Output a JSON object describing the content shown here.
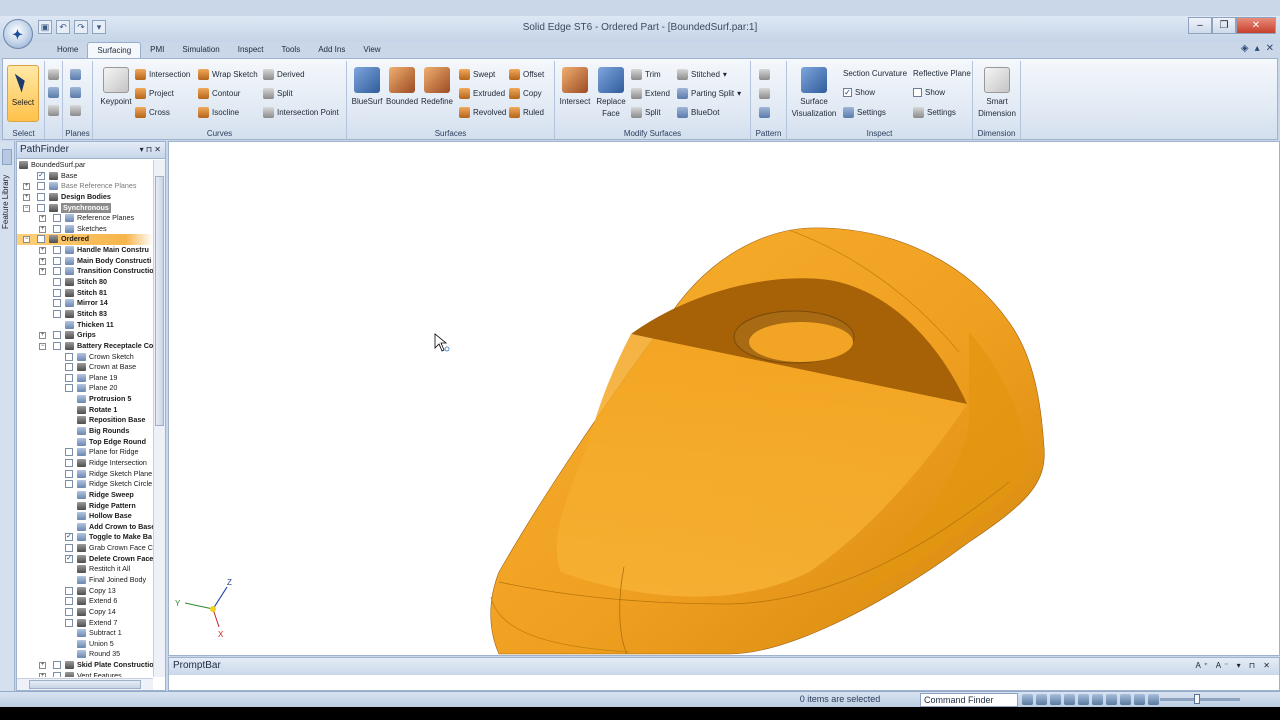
{
  "window": {
    "title": "Solid Edge ST6 - Ordered Part - [BoundedSurf.par:1]"
  },
  "tabs": [
    "Home",
    "Surfacing",
    "PMI",
    "Simulation",
    "Inspect",
    "Tools",
    "Add Ins",
    "View"
  ],
  "active_tab": "Surfacing",
  "ribbon": {
    "select": {
      "label": "Select",
      "group": "Select"
    },
    "planes": {
      "group": "Planes"
    },
    "curves": {
      "group": "Curves",
      "keypoint": "Keypoint",
      "col1": [
        "Intersection",
        "Project",
        "Cross"
      ],
      "col2": [
        "Wrap Sketch",
        "Contour",
        "Isocline"
      ],
      "col3": [
        "Derived",
        "Split",
        "Intersection Point"
      ]
    },
    "surfaces": {
      "group": "Surfaces",
      "big": [
        "BlueSurf",
        "Bounded",
        "Redefine"
      ],
      "col1": [
        "Swept",
        "Extruded",
        "Revolved"
      ],
      "col2": [
        "Offset",
        "Copy",
        "Ruled"
      ]
    },
    "modify": {
      "group": "Modify Surfaces",
      "intersect": "Intersect",
      "replace": "Replace Face",
      "col1": [
        "Trim",
        "Extend",
        "Split"
      ],
      "col2": [
        "Stitched",
        "Parting Split",
        "BlueDot"
      ]
    },
    "pattern": {
      "group": "Pattern"
    },
    "inspect": {
      "group": "Inspect",
      "surface_vis": "Surface Visualization",
      "section_curvature": "Section Curvature",
      "show": "Show",
      "settings": "Settings",
      "reflective_plane": "Reflective Plane",
      "show2": "Show",
      "settings2": "Settings"
    },
    "dimension": {
      "group": "Dimension",
      "smart": "Smart Dimension"
    }
  },
  "side_tab": "Feature Library",
  "pathfinder": {
    "title": "PathFinder",
    "items": [
      "BoundedSurf.par",
      "Base",
      "Base Reference Planes",
      "Design Bodies",
      "Synchronous",
      "Reference Planes",
      "Sketches",
      "Ordered",
      "Handle Main Constru",
      "Main Body Constructi",
      "Transition Constructio",
      "Stitch 80",
      "Stitch 81",
      "Mirror 14",
      "Stitch 83",
      "Thicken 11",
      "Grips",
      "Battery Receptacle Co",
      "Crown Sketch",
      "Crown at Base",
      "Plane 19",
      "Plane 20",
      "Protrusion 5",
      "Rotate 1",
      "Reposition Base",
      "Big Rounds",
      "Top Edge Round",
      "Plane for Ridge",
      "Ridge Intersection",
      "Ridge Sketch Plane",
      "Ridge Sketch Circle",
      "Ridge Sweep",
      "Ridge Pattern",
      "Hollow Base",
      "Add Crown to Base",
      "Toggle to Make Ba",
      "Grab Crown Face C",
      "Delete Crown Face",
      "Restitch it All",
      "Final Joined Body",
      "Copy 13",
      "Extend 6",
      "Copy 14",
      "Extend 7",
      "Subtract 1",
      "Union 5",
      "Round 35",
      "Skid Plate Constructio",
      "Vent Features"
    ]
  },
  "triad": {
    "x": "X",
    "y": "Y",
    "z": "Z"
  },
  "promptbar": {
    "title": "PromptBar"
  },
  "status": {
    "selection": "0 items are selected",
    "command_finder": "Command Finder"
  },
  "colors": {
    "part": "#f0a020",
    "part_dark": "#9c5a05",
    "ribbon": "#dfe8f3"
  }
}
